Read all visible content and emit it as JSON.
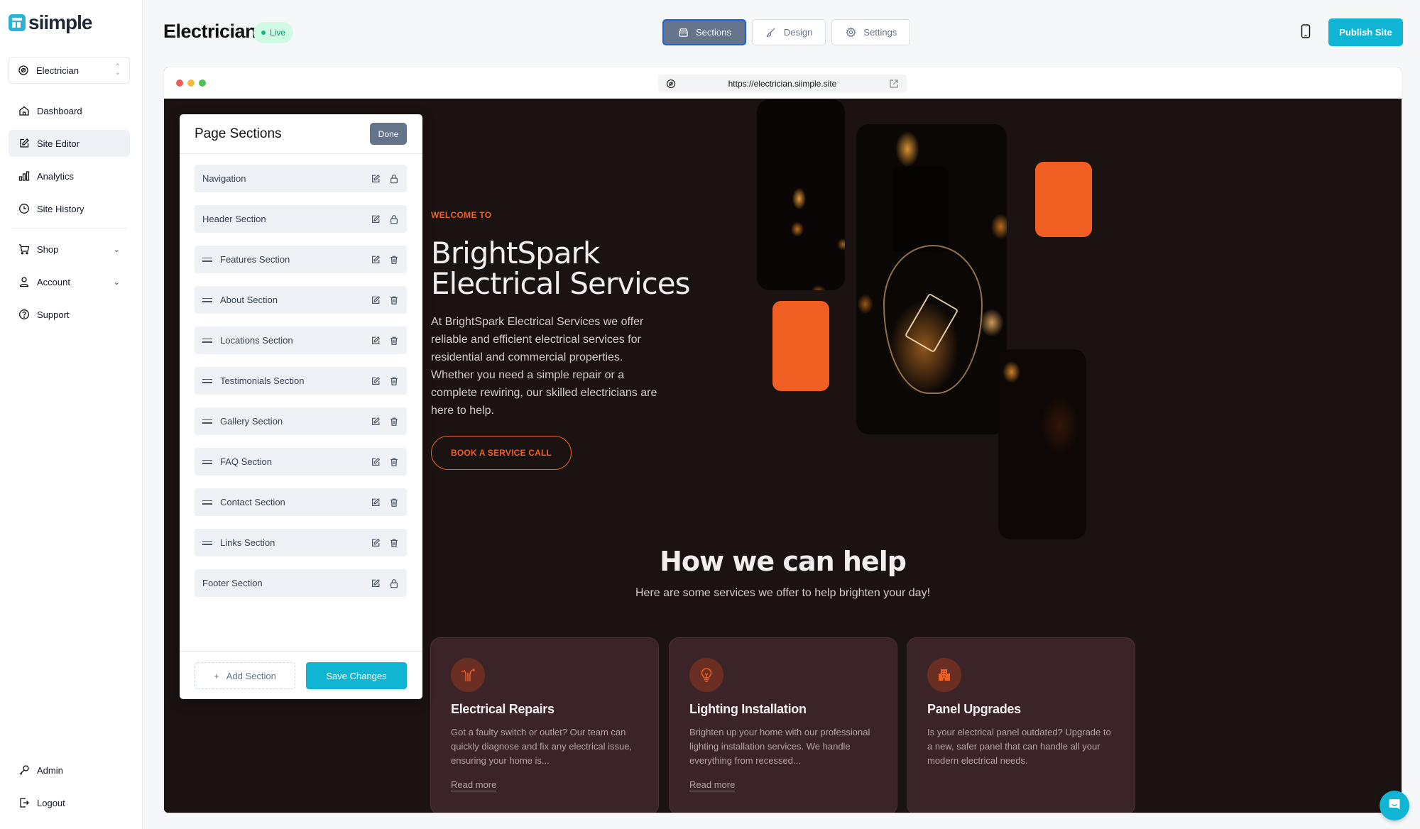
{
  "app": {
    "logo_text": "siimple",
    "site_selector": {
      "value": "Electrician"
    }
  },
  "sidebar": {
    "items": [
      {
        "label": "Dashboard",
        "icon": "home-icon"
      },
      {
        "label": "Site Editor",
        "icon": "edit-icon",
        "active": true
      },
      {
        "label": "Analytics",
        "icon": "bar-chart-icon"
      },
      {
        "label": "Site History",
        "icon": "clock-icon"
      },
      {
        "label": "Shop",
        "icon": "cart-icon",
        "expandable": true
      },
      {
        "label": "Account",
        "icon": "user-icon",
        "expandable": true
      },
      {
        "label": "Support",
        "icon": "help-circle-icon"
      }
    ],
    "bottom_items": [
      {
        "label": "Admin",
        "icon": "key-icon"
      },
      {
        "label": "Logout",
        "icon": "logout-icon"
      }
    ]
  },
  "header": {
    "title": "Electrician",
    "status_badge": "Live",
    "tabs": [
      {
        "label": "Sections",
        "icon": "sections-icon",
        "active": true
      },
      {
        "label": "Design",
        "icon": "brush-icon"
      },
      {
        "label": "Settings",
        "icon": "gear-icon"
      }
    ],
    "device_toggle_icon": "mobile-icon",
    "publish_label": "Publish Site"
  },
  "browser": {
    "url": "https://electrician.siimple.site"
  },
  "page_sections_panel": {
    "title": "Page Sections",
    "done_label": "Done",
    "sections": [
      {
        "label": "Navigation",
        "draggable": false,
        "locked": true
      },
      {
        "label": "Header Section",
        "draggable": false,
        "locked": true
      },
      {
        "label": "Features Section",
        "draggable": true,
        "locked": false
      },
      {
        "label": "About Section",
        "draggable": true,
        "locked": false
      },
      {
        "label": "Locations Section",
        "draggable": true,
        "locked": false
      },
      {
        "label": "Testimonials Section",
        "draggable": true,
        "locked": false
      },
      {
        "label": "Gallery Section",
        "draggable": true,
        "locked": false
      },
      {
        "label": "FAQ Section",
        "draggable": true,
        "locked": false
      },
      {
        "label": "Contact Section",
        "draggable": true,
        "locked": false
      },
      {
        "label": "Links Section",
        "draggable": true,
        "locked": false
      },
      {
        "label": "Footer Section",
        "draggable": false,
        "locked": true
      }
    ],
    "add_section_label": "Add Section",
    "save_label": "Save Changes"
  },
  "site_preview": {
    "hero": {
      "eyebrow": "WELCOME TO",
      "title": "BrightSpark Electrical Services",
      "body": "At BrightSpark Electrical Services we offer reliable and efficient electrical services for residential and commercial properties. Whether you need a simple repair or a complete rewiring, our skilled electricians are here to help.",
      "cta": "BOOK A SERVICE CALL"
    },
    "services": {
      "title": "How we can help",
      "subtitle": "Here are some services we offer to help brighten your day!",
      "cards": [
        {
          "icon": "wires-icon",
          "title": "Electrical Repairs",
          "body": "Got a faulty switch or outlet? Our team can quickly diagnose and fix any electrical issue, ensuring your home is...",
          "link": "Read more"
        },
        {
          "icon": "lightbulb-icon",
          "title": "Lighting Installation",
          "body": "Brighten up your home with our professional lighting installation services. We handle everything from recessed...",
          "link": "Read more"
        },
        {
          "icon": "building-icon",
          "title": "Panel Upgrades",
          "body": "Is your electrical panel outdated? Upgrade to a new, safer panel that can handle all your modern electrical needs.",
          "link": ""
        }
      ]
    }
  },
  "colors": {
    "brand": "#0fb5d3",
    "accent_orange": "#f15f22",
    "site_bg": "#1b1212",
    "card_bg": "#3b2427",
    "live_green": "#10b981"
  }
}
